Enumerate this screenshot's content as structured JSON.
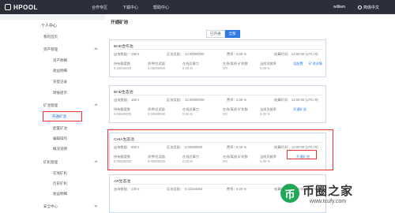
{
  "topbar": {
    "logo": "HPOOL",
    "nav": [
      "合作专区",
      "下载中心",
      "帮助中心"
    ],
    "user": "william",
    "lang": "简体中文"
  },
  "sidebar": {
    "personal_center": "个人中心",
    "my_overview": "我的首页",
    "asset_mgmt": "资产管理",
    "asset_items": [
      "资产明细",
      "收益明细",
      "充提记录",
      "转账提币"
    ],
    "miner_mgmt": "矿池管理",
    "miner_items": [
      "开通矿池",
      "配置矿池",
      "编辑操作",
      "概况说明"
    ],
    "machine_mgmt": "矿机管理",
    "machine_items": [
      "在线矿机",
      "历史矿机",
      "收益明细"
    ],
    "security": "安全中心"
  },
  "main": {
    "title": "开通矿池",
    "toggle": [
      "已开通",
      "全部"
    ],
    "cards": [
      {
        "title": "BHD合作池",
        "row1": [
          "出块数据：",
          "180 s",
          "区块奖励：",
          "13.00000000",
          "费率：",
          "3.00 %",
          "结算时间：",
          "12:00:00 (UTC+8)"
        ],
        "row2": [
          "持有额度数",
          "质押/总奖励",
          "在线总算力",
          "在线/离线 矿机数",
          "当前贡献率"
        ],
        "row3": [
          "0.00000000",
          "0.00000000",
          "0.00 Ib",
          "0/0",
          "0.00 %"
        ],
        "links": [
          "设配置",
          "矿池详情"
        ]
      },
      {
        "title": "BHD生态池",
        "row1": [
          "出块数据：",
          "180 s",
          "区块奖励：",
          "15.00000000",
          "费率：",
          "2.00 %",
          "结算时间：",
          "12:00:00 (UTC+8)"
        ],
        "row2": [
          "持有额度数",
          "质押/总奖励",
          "在线总算力",
          "在线/离线 矿机数",
          "当前贡献率"
        ],
        "row3": [
          "0.00000000",
          "0.00000000",
          "0.00 Ib",
          "0/0",
          "0.00 %"
        ],
        "links": [
          "开通矿池"
        ]
      },
      {
        "title": "CHIA生态池",
        "row1": [
          "出块数据：",
          "600 s",
          "区块奖励：",
          "2.00000000",
          "费率：",
          "5.00 %",
          "结算时间：",
          "12:00:00 (UTC+8)"
        ],
        "row2": [
          "持有额度数",
          "质押/总奖励",
          "在线总算力",
          "在线/离线 矿机数",
          "当前贡献率"
        ],
        "row3": [
          "0.00000000",
          "0.00000000",
          "0.00 Ib",
          "0/0",
          "0.00 %"
        ],
        "links": [
          "开通矿池"
        ]
      },
      {
        "title": "AR生态池",
        "row1": [
          "出块数据：",
          "120 s",
          "区块奖励：",
          "0.22104063",
          "费率：",
          "5.00 %",
          "结算时间：",
          "12:00:00 (UTC+8)"
        ]
      }
    ]
  },
  "watermark": {
    "icon": "币",
    "text": "币圈之家",
    "url": "www.tcufy.com"
  },
  "colors": {
    "accent": "#2f7ae5",
    "highlight": "#e33333",
    "topbar": "#2b2f3a"
  }
}
